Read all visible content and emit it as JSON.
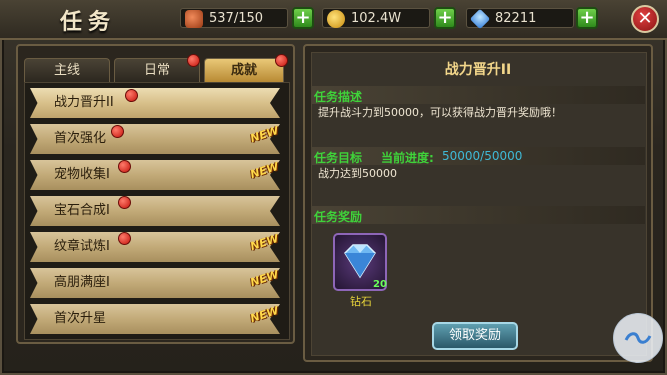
{
  "header": {
    "title": "任务",
    "stamina": "537/150",
    "gold": "102.4W",
    "diamonds": "82211"
  },
  "tabs": [
    {
      "label": "主线",
      "active": false
    },
    {
      "label": "日常",
      "active": false
    },
    {
      "label": "成就",
      "active": true
    }
  ],
  "tasks": [
    {
      "label": "战力晋升II",
      "selected": true,
      "has_dot": true,
      "is_new": false
    },
    {
      "label": "首次强化",
      "selected": false,
      "has_dot": true,
      "is_new": true
    },
    {
      "label": "宠物收集I",
      "selected": false,
      "has_dot": true,
      "is_new": true
    },
    {
      "label": "宝石合成I",
      "selected": false,
      "has_dot": true,
      "is_new": false
    },
    {
      "label": "纹章试炼I",
      "selected": false,
      "has_dot": true,
      "is_new": true
    },
    {
      "label": "高朋满座I",
      "selected": false,
      "has_dot": false,
      "is_new": true
    },
    {
      "label": "首次升星",
      "selected": false,
      "has_dot": false,
      "is_new": true
    }
  ],
  "new_badge": "NEW",
  "detail": {
    "title": "战力晋升II",
    "desc_label": "任务描述",
    "desc_text": "提升战斗力到50000，可以获得战力晋升奖励哦！",
    "goal_label": "任务目标",
    "progress_label": "当前进度:",
    "progress_value": "50000/50000",
    "goal_text": "战力达到50000",
    "reward_label": "任务奖励",
    "reward_item": "钻石",
    "reward_count": "20",
    "claim_button": "领取奖励"
  },
  "colors": {
    "accent_green": "#3fd23a",
    "progress_cyan": "#3fb9d6",
    "badge_yellow": "#ffd84a"
  }
}
